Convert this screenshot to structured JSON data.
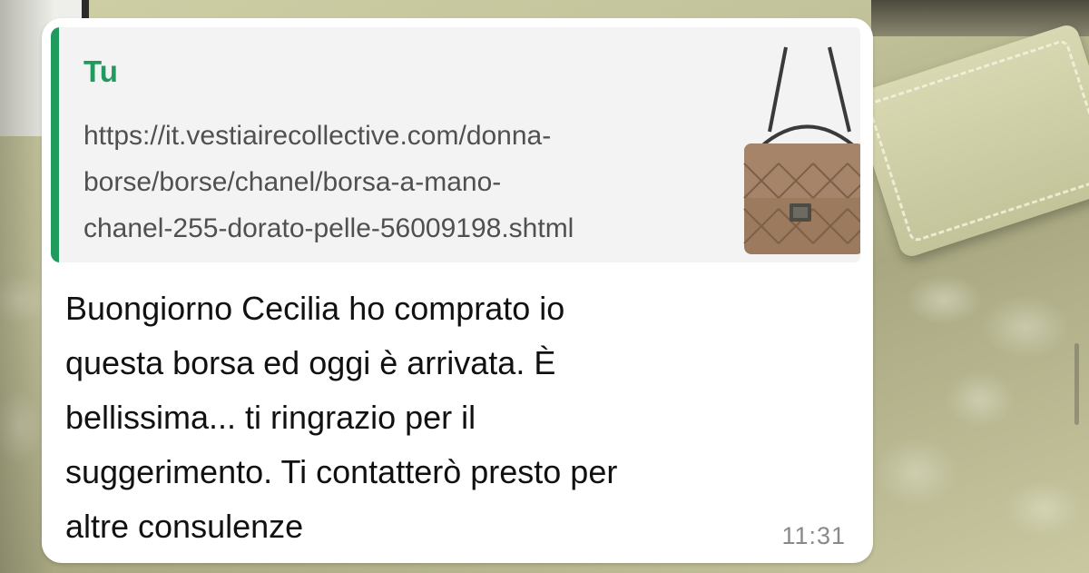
{
  "chat": {
    "message": {
      "quoted": {
        "author": "Tu",
        "text": "https://it.vestiairecollective.com/donna-\nborse/borse/chanel/borsa-a-mano-\nchanel-255-dorato-pelle-56009198.shtml",
        "thumbnail_icon": "handbag-thumbnail-image"
      },
      "body": "Buongiorno Cecilia ho comprato io\nquesta borsa ed oggi è arrivata. È\nbellissima... ti ringrazio per il\nsuggerimento. Ti contatterò presto per\naltre consulenze",
      "time": "11:31"
    }
  },
  "colors": {
    "quote_accent": "#1f9b5e",
    "bubble": "#ffffff",
    "quote_background": "#f3f3f3",
    "timestamp": "#8a8a8a"
  }
}
